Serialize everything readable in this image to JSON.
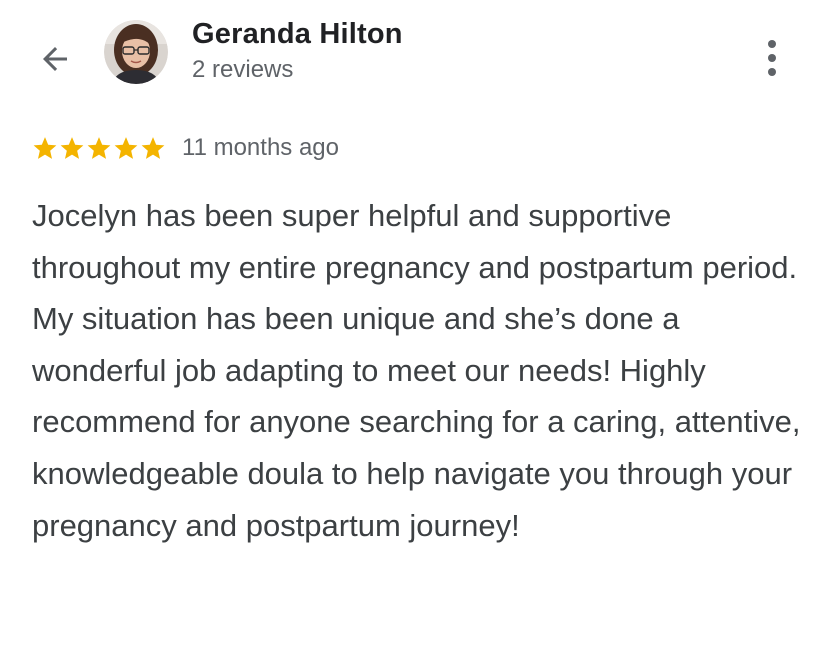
{
  "header": {
    "back_icon": "arrow-back-icon",
    "avatar_icon": "avatar-photo",
    "reviewer_name": "Geranda Hilton",
    "review_count": "2 reviews",
    "menu_icon": "more-vert-icon"
  },
  "review": {
    "rating": 5,
    "rating_max": 5,
    "star_color": "#f4b400",
    "date": "11 months ago",
    "text": "Jocelyn has been super helpful and supportive throughout my entire pregnancy and postpartum period. My situation has been unique and she’s done a wonderful job adapting to meet our needs! Highly recommend for anyone searching for a caring, attentive, knowledgeable doula to help navigate you through your pregnancy and postpartum journey!"
  }
}
